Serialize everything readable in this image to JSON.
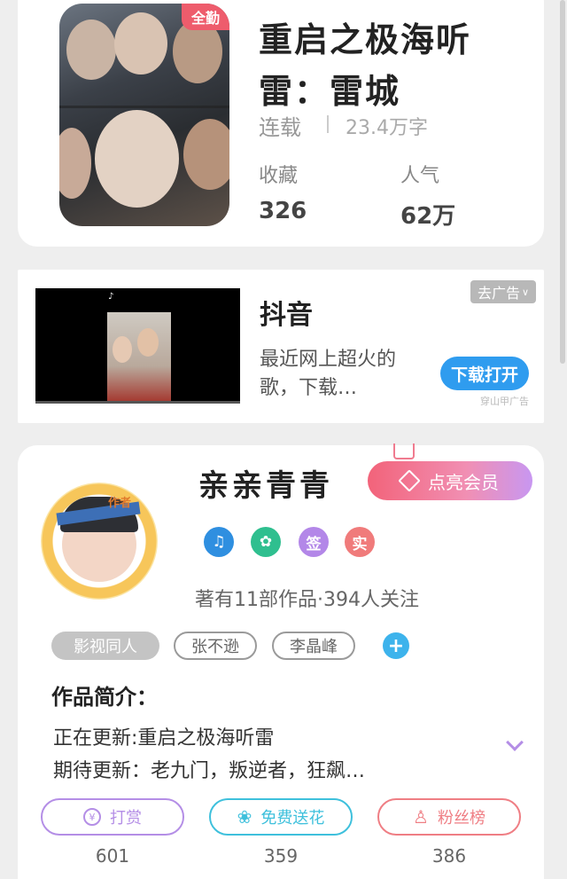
{
  "book": {
    "badge": "全勤",
    "title": "重启之极海听雷：雷城",
    "status": "连载",
    "word_count": "23.4万字",
    "stats": [
      {
        "label": "收藏",
        "value": "326"
      },
      {
        "label": "人气",
        "value": "62万"
      }
    ]
  },
  "ad": {
    "title": "抖音",
    "description": "最近网上超火的歌，下载…",
    "remove_label": "去广告",
    "download_label": "下载打开",
    "source": "穿山甲广告",
    "video_logo": "♪"
  },
  "author": {
    "name": "亲亲青青",
    "avatar_tag": "作者",
    "vip_button": "点亮会员",
    "medals": [
      {
        "symbol": "♫",
        "color": "#2f8fe0"
      },
      {
        "symbol": "✿",
        "color": "#2fbf8f"
      },
      {
        "symbol": "签",
        "color": "#b387e8"
      },
      {
        "symbol": "实",
        "color": "#f07b7b"
      }
    ],
    "meta": "著有11部作品·394人关注",
    "tags": [
      "影视同人",
      "张不逊",
      "李晶峰"
    ],
    "add_tag": "+",
    "intro_heading": "作品简介：",
    "intro_lines": [
      "正在更新:重启之极海听雷",
      "期待更新：老九门，叛逆者，狂飙…"
    ],
    "actions": [
      {
        "label": "打赏",
        "icon": "¥",
        "count": "601",
        "color": "#b48ee6"
      },
      {
        "label": "免费送花",
        "icon": "❀",
        "count": "359",
        "color": "#3ec0dc"
      },
      {
        "label": "粉丝榜",
        "icon": "♙",
        "count": "386",
        "color": "#ef7e84"
      }
    ]
  }
}
